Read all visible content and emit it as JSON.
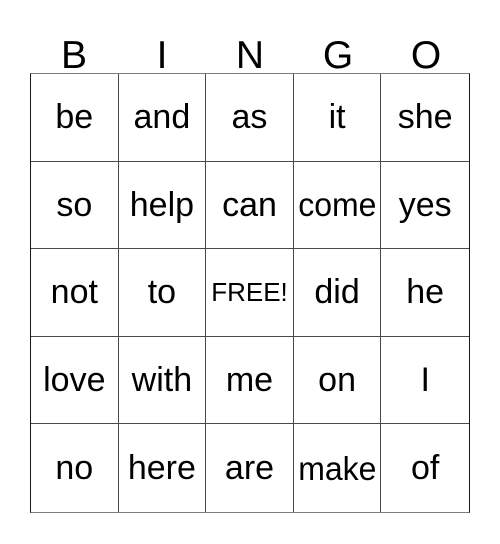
{
  "card": {
    "title": "BINGO",
    "headers": [
      "B",
      "I",
      "N",
      "G",
      "O"
    ],
    "rows": [
      {
        "cells": [
          {
            "text": "be"
          },
          {
            "text": "and"
          },
          {
            "text": "as"
          },
          {
            "text": "it"
          },
          {
            "text": "she"
          }
        ]
      },
      {
        "cells": [
          {
            "text": "so"
          },
          {
            "text": "help"
          },
          {
            "text": "can"
          },
          {
            "text": "come"
          },
          {
            "text": "yes"
          }
        ]
      },
      {
        "cells": [
          {
            "text": "not"
          },
          {
            "text": "to"
          },
          {
            "text": "FREE!"
          },
          {
            "text": "did"
          },
          {
            "text": "he"
          }
        ]
      },
      {
        "cells": [
          {
            "text": "love"
          },
          {
            "text": "with"
          },
          {
            "text": "me"
          },
          {
            "text": "on"
          },
          {
            "text": "I"
          }
        ]
      },
      {
        "cells": [
          {
            "text": "no"
          },
          {
            "text": "here"
          },
          {
            "text": "are"
          },
          {
            "text": "make"
          },
          {
            "text": "of"
          }
        ]
      }
    ]
  },
  "colors": {
    "background": "#ffffff",
    "text": "#000000",
    "grid_line": "#4a4a4a",
    "outer_border": "#1a1a1a"
  }
}
